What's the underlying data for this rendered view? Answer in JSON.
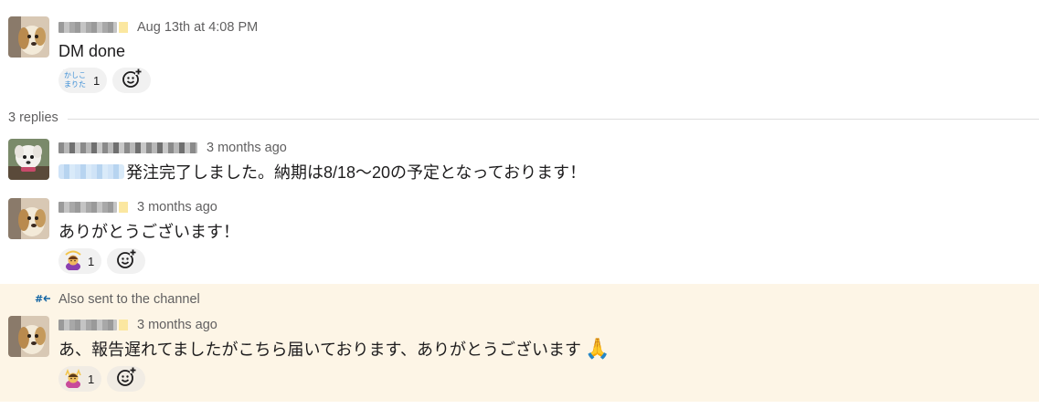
{
  "parent_message": {
    "timestamp": "Aug 13th at 4:08 PM",
    "text": "DM done",
    "reactions": [
      {
        "emoji_name": "kashikomarimashita-emoji",
        "count": "1"
      }
    ]
  },
  "replies_divider": {
    "label": "3 replies"
  },
  "replies": [
    {
      "timestamp": "3 months ago",
      "text": "発注完了しました。納期は8/18〜20の予定となっております！"
    },
    {
      "timestamp": "3 months ago",
      "text": "ありがとうございます！",
      "reactions": [
        {
          "emoji_name": "woman-gesturing-ok-emoji",
          "count": "1"
        }
      ]
    },
    {
      "channel_note": "Also sent to the channel",
      "timestamp": "3 months ago",
      "text": "あ、報告遅れてましたがこちら届いております、ありがとうございます",
      "emoji": "🙏",
      "reactions": [
        {
          "emoji_name": "celebrating-person-emoji",
          "count": "1"
        }
      ]
    }
  ],
  "colors": {
    "timestamp": "#616061",
    "text": "#1d1c1d",
    "highlight_bg": "#fdf5e6",
    "reaction_bg": "#f1f1f1",
    "divider": "#dddddd",
    "channel_icon": "#1264a3"
  }
}
